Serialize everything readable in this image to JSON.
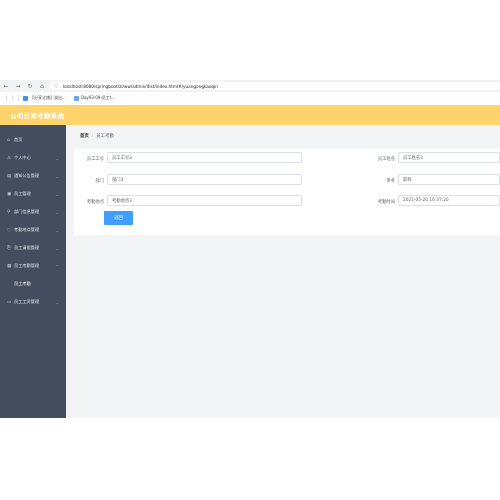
{
  "browser": {
    "url": "localhost:8080/springboot/zl/ww/admin/dist/index.html#/yuangongkaoqin",
    "bookmarks": [
      {
        "label": "【分享之旅】说出..."
      },
      {
        "label": "Day03-09-员工t..."
      }
    ]
  },
  "app": {
    "title": "公司日常考勤系统"
  },
  "sidebar": {
    "items": [
      {
        "label": "首页",
        "icon": "home-icon"
      },
      {
        "label": "个人中心",
        "icon": "user-icon"
      },
      {
        "label": "通知公告管理",
        "icon": "notice-icon"
      },
      {
        "label": "员工管理",
        "icon": "staff-icon"
      },
      {
        "label": "部门信息管理",
        "icon": "dept-icon"
      },
      {
        "label": "考勤地点管理",
        "icon": "location-icon"
      },
      {
        "label": "员工请假管理",
        "icon": "leave-icon"
      },
      {
        "label": "员工考勤管理",
        "icon": "attendance-icon"
      },
      {
        "label": "员工考勤",
        "icon": ""
      },
      {
        "label": "员工工资管理",
        "icon": "salary-icon"
      }
    ]
  },
  "breadcrumb": {
    "home": "首页",
    "separator": "/",
    "current": "员工考勤"
  },
  "form": {
    "employee_no": {
      "label": "员工工号",
      "value": "员工工号3"
    },
    "employee_name": {
      "label": "员工姓名",
      "value": "员工姓名3"
    },
    "department": {
      "label": "部门",
      "value": "部门3"
    },
    "position": {
      "label": "参考",
      "value": "职称"
    },
    "location": {
      "label": "考勤地点",
      "value": "考勤地点3"
    },
    "time": {
      "label": "考勤时间",
      "value": "2021-05-20 16:37:20"
    },
    "submit_label": "返回"
  },
  "colors": {
    "topbar": "#ffd36b",
    "sidebar": "#434d5e",
    "primary": "#409eff"
  }
}
